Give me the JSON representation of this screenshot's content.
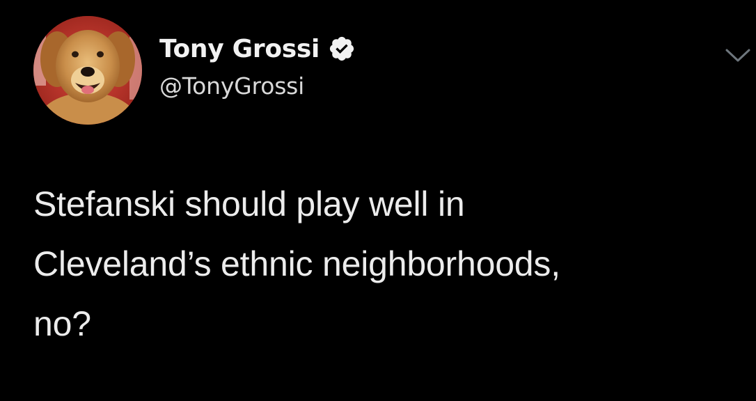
{
  "tweet": {
    "author": {
      "display_name": "Tony Grossi",
      "handle": "@TonyGrossi",
      "verified": true,
      "avatar": "golden-retriever-avatar"
    },
    "text_lines": [
      "Stefanski should play well in",
      "Cleveland’s ethnic neighborhoods,",
      "no?"
    ],
    "menu_icon": "chevron-down-icon"
  },
  "colors": {
    "background": "#000000",
    "name": "#f2f2f2",
    "handle": "#d9d9d9",
    "text": "#ececec",
    "chevron": "#6e767d"
  }
}
